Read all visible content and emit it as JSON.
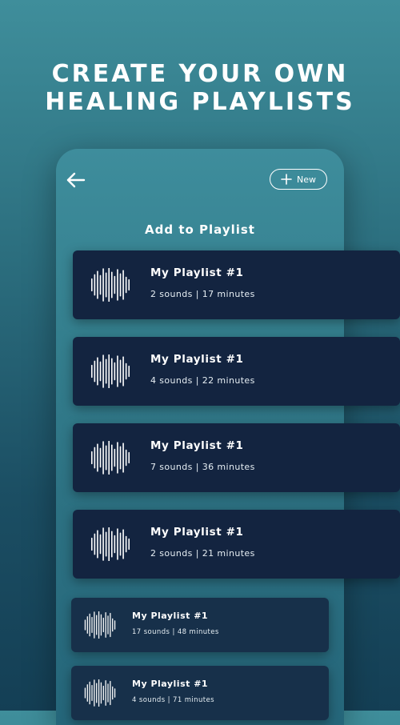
{
  "headline": {
    "line1": "CREATE YOUR OWN",
    "line2": "HEALING PLAYLISTS"
  },
  "screen": {
    "title": "Add to Playlist",
    "new_button_label": "New"
  },
  "icons": {
    "back": "arrow-left-icon",
    "new": "plus-icon",
    "playlist": "sound-wave-icon"
  },
  "colors": {
    "background_top": "#3f8e9b",
    "background_bottom": "#143f55",
    "card": "#132440",
    "text": "#ffffff"
  },
  "playlists": [
    {
      "name": "My Playlist #1",
      "meta": "2 sounds | 17 minutes"
    },
    {
      "name": "My Playlist #1",
      "meta": "4 sounds | 22 minutes"
    },
    {
      "name": "My Playlist #1",
      "meta": "7 sounds | 36 minutes"
    },
    {
      "name": "My Playlist #1",
      "meta": "2 sounds | 21 minutes"
    },
    {
      "name": "My Playlist #1",
      "meta": "17 sounds | 48 minutes"
    },
    {
      "name": "My Playlist #1",
      "meta": "4 sounds | 71 minutes"
    }
  ]
}
